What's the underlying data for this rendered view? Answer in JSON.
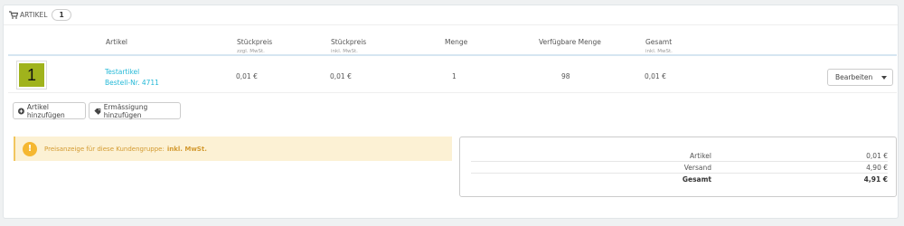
{
  "header": {
    "title": "Artikel",
    "count": "1"
  },
  "table": {
    "columns": [
      {
        "label": "Artikel",
        "sub": ""
      },
      {
        "label": "Stückpreis",
        "sub": "zzgl. MwSt."
      },
      {
        "label": "Stückpreis",
        "sub": "inkl. MwSt."
      },
      {
        "label": "Menge",
        "sub": ""
      },
      {
        "label": "Verfügbare Menge",
        "sub": ""
      },
      {
        "label": "Gesamt",
        "sub": "inkl. MwSt."
      }
    ],
    "rows": [
      {
        "thumb_label": "1",
        "name": "Testartikel",
        "ref": "Bestell-Nr. 4711",
        "unit_excl": "0,01 €",
        "unit_incl": "0,01 €",
        "qty": "1",
        "available": "98",
        "total": "0,01 €",
        "edit_label": "Bearbeiten"
      }
    ]
  },
  "actions": {
    "add_product": "Artikel hinzufügen",
    "add_discount": "Ermässigung hinzufügen"
  },
  "notice": {
    "text": "Preisanzeige für diese Kundengruppe:",
    "strong": "inkl. MwSt."
  },
  "summary": [
    {
      "label": "Artikel",
      "value": "0,01 €"
    },
    {
      "label": "Versand",
      "value": "4,90 €"
    },
    {
      "label": "Gesamt",
      "value": "4,91 €"
    }
  ],
  "colors": {
    "link": "#25b9d7",
    "thumb": "#a0b31c",
    "alert_bg": "#fcf1d4",
    "alert_icon": "#f5b731"
  }
}
